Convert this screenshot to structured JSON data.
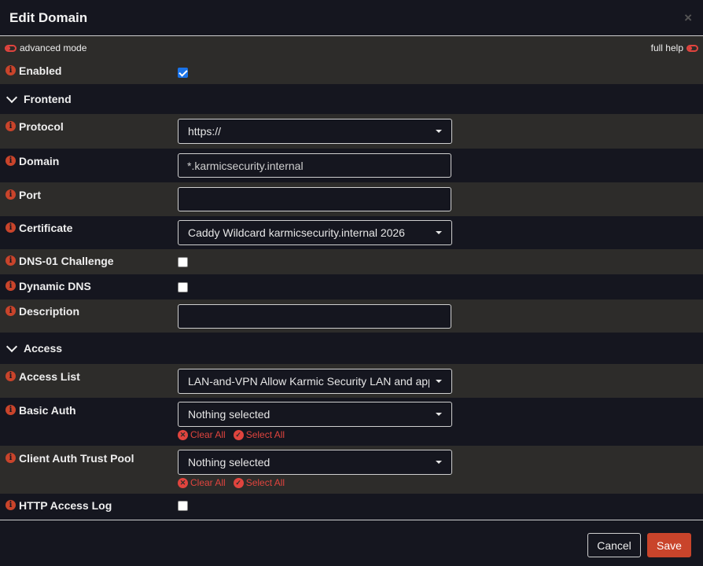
{
  "dialog": {
    "title": "Edit Domain",
    "close": "×"
  },
  "modebar": {
    "advanced_mode": "advanced mode",
    "full_help": "full help"
  },
  "rows": {
    "enabled": {
      "label": "Enabled",
      "checked": true
    },
    "protocol": {
      "label": "Protocol",
      "value": "https://"
    },
    "domain": {
      "label": "Domain",
      "value": "*.karmicsecurity.internal"
    },
    "port": {
      "label": "Port",
      "value": ""
    },
    "certificate": {
      "label": "Certificate",
      "value": "Caddy Wildcard karmicsecurity.internal 2026"
    },
    "dns01": {
      "label": "DNS-01 Challenge",
      "checked": false
    },
    "dynamic_dns": {
      "label": "Dynamic DNS",
      "checked": false
    },
    "description": {
      "label": "Description",
      "value": ""
    },
    "access_list": {
      "label": "Access List",
      "value": "LAN-and-VPN Allow Karmic Security LAN and appr"
    },
    "basic_auth": {
      "label": "Basic Auth",
      "value": "Nothing selected"
    },
    "client_auth": {
      "label": "Client Auth Trust Pool",
      "value": "Nothing selected"
    },
    "http_log": {
      "label": "HTTP Access Log",
      "checked": false
    }
  },
  "sections": {
    "frontend": "Frontend",
    "access": "Access"
  },
  "multi_actions": {
    "clear_all": "Clear All",
    "select_all": "Select All"
  },
  "footer": {
    "cancel": "Cancel",
    "save": "Save"
  },
  "colors": {
    "accent": "#c9442b",
    "link": "#e0443e",
    "row_alt": "#2d2c2a",
    "background": "#15161f"
  },
  "icons": {
    "info": "info-icon",
    "section": "chevron-down-icon",
    "clear": "x-circle-icon",
    "select": "check-circle-icon"
  }
}
